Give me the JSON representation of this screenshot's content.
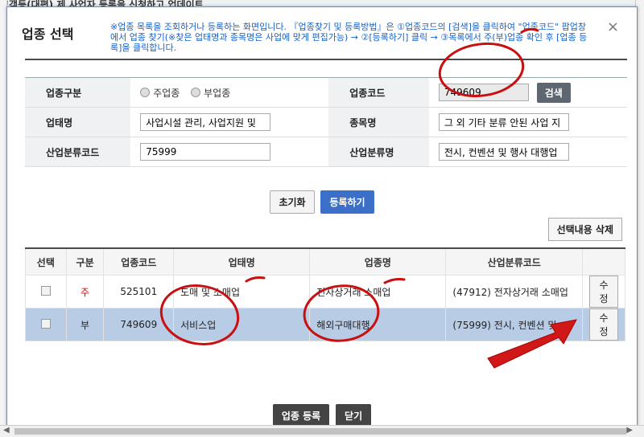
{
  "background": {
    "top_text": "고객등(대편)  제 사업자 등록을 신청하고 업데이트"
  },
  "modal": {
    "title": "업종 선택",
    "notice": "※업종 목록을 조회하거나 등록하는 화면입니다. 『업종찾기 및 등록방법』은 ①업종코드의 [검색]을 클릭하여 \"업종코드\" 팝업창에서 업종 찾기(※찾은 업태명과 종목명은 사업에 맞게 편집가능) → ②[등록하기] 클릭 → ③목록에서 주(부)업종 확인 후 [업종 등록]을 클릭합니다.",
    "close_icon": "×"
  },
  "form": {
    "type_label": "업종구분",
    "radio_main": "주업종",
    "radio_sub": "부업종",
    "code_label": "업종코드",
    "code_value": "749609",
    "search_button": "검색",
    "business_label": "업태명",
    "business_value": "사업시설 관리, 사업지원 및",
    "item_label": "종목명",
    "item_value": "그 외 기타 분류 안된 사업 지",
    "industry_code_label": "산업분류코드",
    "industry_code_value": "75999",
    "industry_name_label": "산업분류명",
    "industry_name_value": "전시, 컨벤션 및 행사 대행업"
  },
  "actions": {
    "reset": "초기화",
    "register": "등록하기",
    "delete_selected": "선택내용 삭제"
  },
  "grid": {
    "headers": [
      "선택",
      "구분",
      "업종코드",
      "업태명",
      "업종명",
      "산업분류코드",
      ""
    ],
    "rows": [
      {
        "type": "주",
        "code": "525101",
        "business": "도매 및 소매업",
        "item": "전자상거래 소매업",
        "industry": "(47912) 전자상거래 소매업",
        "edit": "수정"
      },
      {
        "type": "부",
        "code": "749609",
        "business": "서비스업",
        "item": "해외구매대행",
        "industry": "(75999) 전시, 컨벤션 및 …",
        "edit": "수정"
      }
    ]
  },
  "footer": {
    "register": "업종 등록",
    "close": "닫기"
  },
  "colors": {
    "accent_blue": "#3c6fc8",
    "notice_blue": "#1660c8",
    "annotation_red": "#c81010",
    "selected_row": "#b9cce6"
  }
}
